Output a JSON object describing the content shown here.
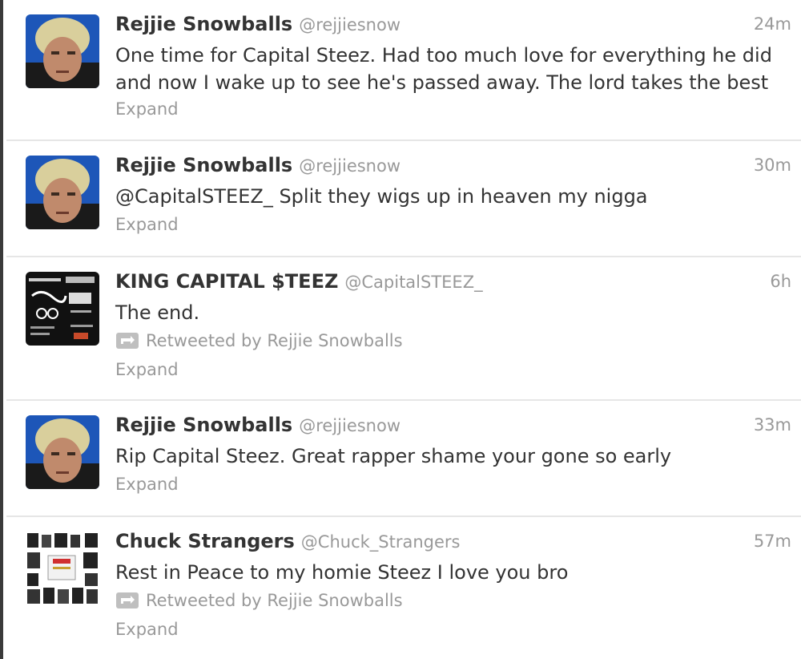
{
  "tweets": [
    {
      "avatar_icon": "rejjie-avatar",
      "fullname": "Rejjie Snowballs",
      "username": "@rejjiesnow",
      "time": "24m",
      "text_lines": [
        "One time for Capital Steez. Had too much love for everything he did",
        "and now I wake up to see he's passed away. The lord takes the best"
      ],
      "expand": "Expand"
    },
    {
      "avatar_icon": "rejjie-avatar",
      "fullname": "Rejjie Snowballs",
      "username": "@rejjiesnow",
      "time": "30m",
      "text": "@CapitalSTEEZ_ Split they wigs up in heaven my nigga",
      "expand": "Expand"
    },
    {
      "avatar_icon": "flyer-avatar",
      "fullname": "KING CAPITAL $TEEZ",
      "username": "@CapitalSTEEZ_",
      "time": "6h",
      "text": "The end.",
      "retweet_icon": "retweet-icon",
      "retweeted_by": "Retweeted by Rejjie Snowballs",
      "expand": "Expand"
    },
    {
      "avatar_icon": "rejjie-avatar",
      "fullname": "Rejjie Snowballs",
      "username": "@rejjiesnow",
      "time": "33m",
      "text": "Rip Capital Steez. Great rapper shame your gone so early",
      "expand": "Expand"
    },
    {
      "avatar_icon": "collage-avatar",
      "fullname": "Chuck Strangers",
      "username": "@Chuck_Strangers",
      "time": "57m",
      "text": "Rest in Peace to my homie Steez I love you bro",
      "retweet_icon": "retweet-icon",
      "retweeted_by": "Retweeted by Rejjie Snowballs",
      "expand": "Expand"
    }
  ]
}
